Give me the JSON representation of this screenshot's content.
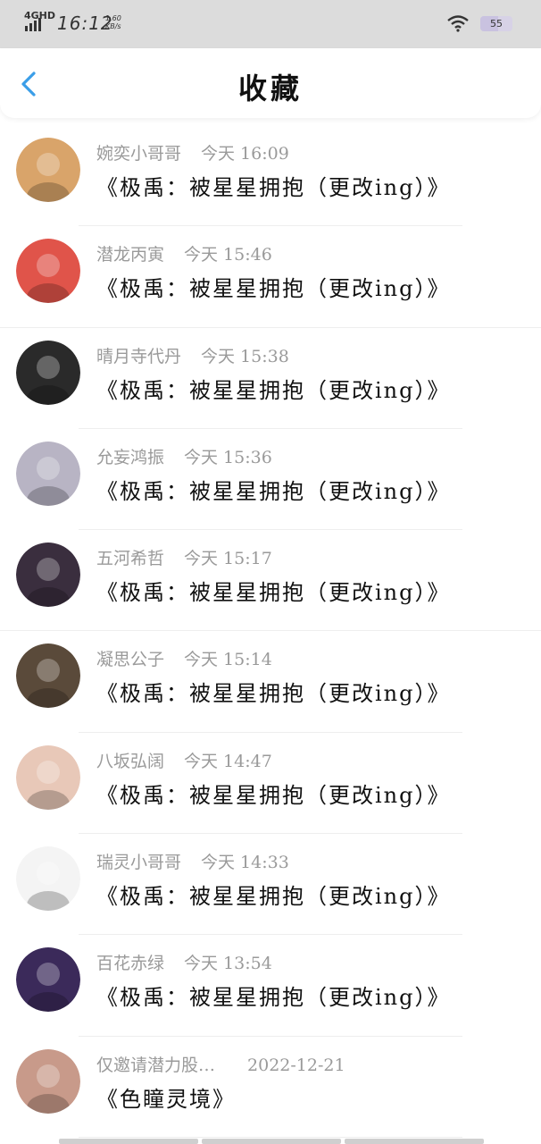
{
  "status_bar": {
    "network": "4GHD",
    "time": "16:12",
    "speed_value": "1.60",
    "speed_unit": "KB/s",
    "battery": "55"
  },
  "header": {
    "title": "收藏",
    "back_icon": "chevron-left-icon"
  },
  "items": [
    {
      "user": "婉奕小哥哥",
      "time": "今天 16:09",
      "post": "《极禹：被星星拥抱（更改ing）》",
      "avatar_color": "#d9a46a"
    },
    {
      "user": "潜龙丙寅",
      "time": "今天 15:46",
      "post": "《极禹：被星星拥抱（更改ing）》",
      "avatar_color": "#e0544a"
    },
    {
      "user": "晴月寺代丹",
      "time": "今天 15:38",
      "post": "《极禹：被星星拥抱（更改ing）》",
      "avatar_color": "#2a2a2a"
    },
    {
      "user": "允妄鸿振",
      "time": "今天 15:36",
      "post": "《极禹：被星星拥抱（更改ing）》",
      "avatar_color": "#b8b4c4"
    },
    {
      "user": "五河希哲",
      "time": "今天 15:17",
      "post": "《极禹：被星星拥抱（更改ing）》",
      "avatar_color": "#3a2e3e"
    },
    {
      "user": "凝思公子",
      "time": "今天 15:14",
      "post": "《极禹：被星星拥抱（更改ing）》",
      "avatar_color": "#5a4a3a"
    },
    {
      "user": "八坂弘阔",
      "time": "今天 14:47",
      "post": "《极禹：被星星拥抱（更改ing）》",
      "avatar_color": "#e8c8b8"
    },
    {
      "user": "瑞灵小哥哥",
      "time": "今天 14:33",
      "post": "《极禹：被星星拥抱（更改ing）》",
      "avatar_color": "#f4f4f4"
    },
    {
      "user": "百花赤绿",
      "time": "今天 13:54",
      "post": "《极禹：被星星拥抱（更改ing）》",
      "avatar_color": "#3b2a5a"
    },
    {
      "user": "仅邀请潜力股…",
      "time": "2022-12-21",
      "post": "《色瞳灵境》",
      "avatar_color": "#c89a8a"
    }
  ]
}
